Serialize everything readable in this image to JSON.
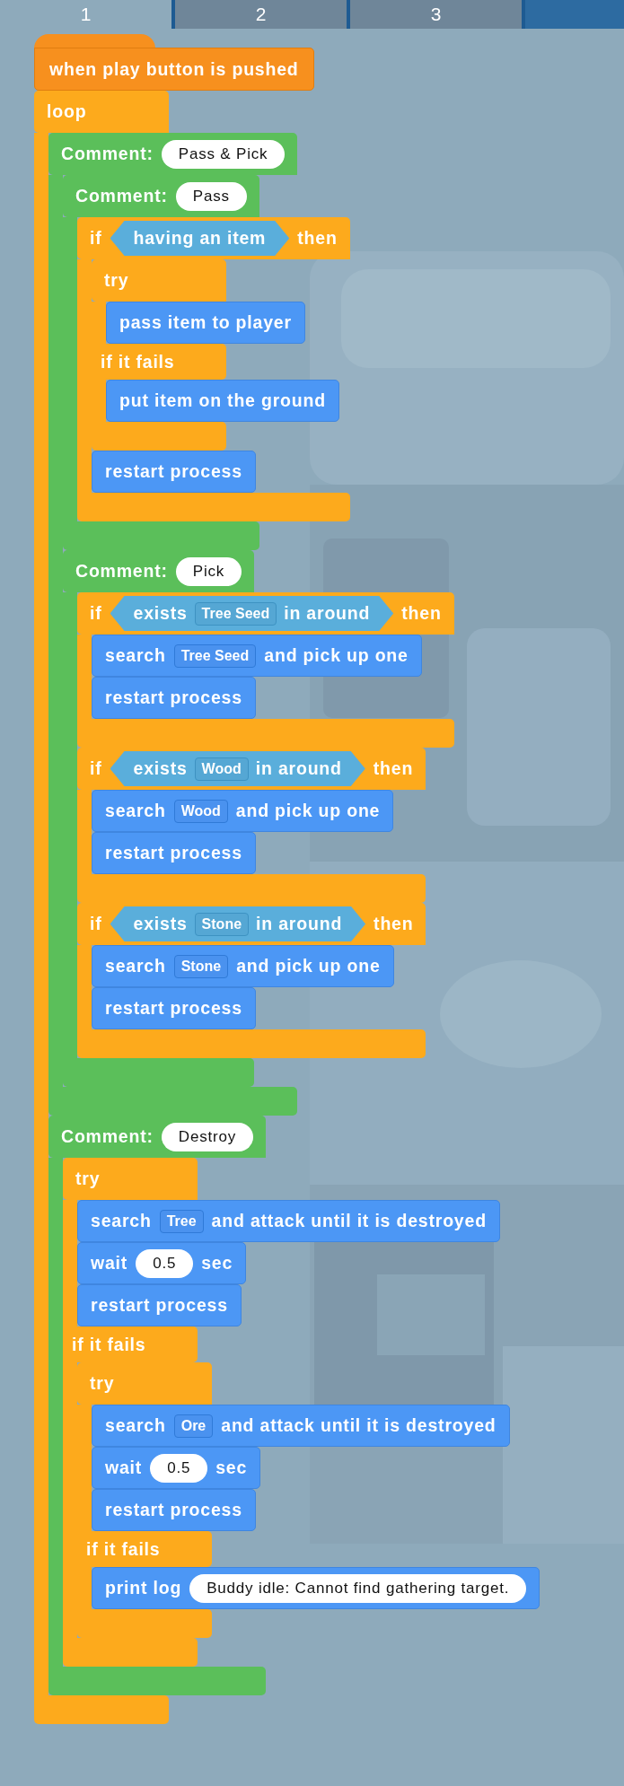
{
  "tabs": [
    {
      "label": "1",
      "selected": true
    },
    {
      "label": "2",
      "selected": false
    },
    {
      "label": "3",
      "selected": false
    }
  ],
  "script": [
    {
      "kind": "hat",
      "text": "when play button is pushed"
    },
    {
      "kind": "loop",
      "label": "loop",
      "body": [
        {
          "kind": "comment",
          "label": "Comment:",
          "value": "Pass & Pick",
          "body": [
            {
              "kind": "comment",
              "label": "Comment:",
              "value": "Pass",
              "body": [
                {
                  "kind": "if",
                  "header": [
                    {
                      "kind": "text",
                      "text": "if"
                    },
                    {
                      "kind": "condition",
                      "segments": [
                        {
                          "kind": "text",
                          "text": "having an item"
                        }
                      ]
                    },
                    {
                      "kind": "text",
                      "text": "then"
                    }
                  ],
                  "body": [
                    {
                      "kind": "try",
                      "label": "try",
                      "body": [
                        {
                          "kind": "command",
                          "segments": [
                            {
                              "kind": "text",
                              "text": "pass item to player"
                            }
                          ]
                        }
                      ],
                      "fail_label": "if it fails",
                      "fail_body": [
                        {
                          "kind": "command",
                          "segments": [
                            {
                              "kind": "text",
                              "text": "put item on the ground"
                            }
                          ]
                        }
                      ]
                    },
                    {
                      "kind": "command",
                      "segments": [
                        {
                          "kind": "text",
                          "text": "restart process"
                        }
                      ]
                    }
                  ]
                }
              ]
            },
            {
              "kind": "comment",
              "label": "Comment:",
              "value": "Pick",
              "body": [
                {
                  "kind": "if",
                  "header": [
                    {
                      "kind": "text",
                      "text": "if"
                    },
                    {
                      "kind": "condition",
                      "segments": [
                        {
                          "kind": "text",
                          "text": "exists"
                        },
                        {
                          "kind": "slot",
                          "text": "Tree Seed"
                        },
                        {
                          "kind": "text",
                          "text": "in around"
                        }
                      ]
                    },
                    {
                      "kind": "text",
                      "text": "then"
                    }
                  ],
                  "body": [
                    {
                      "kind": "command",
                      "segments": [
                        {
                          "kind": "text",
                          "text": "search"
                        },
                        {
                          "kind": "slot",
                          "text": "Tree Seed"
                        },
                        {
                          "kind": "text",
                          "text": "and pick up one"
                        }
                      ]
                    },
                    {
                      "kind": "command",
                      "segments": [
                        {
                          "kind": "text",
                          "text": "restart process"
                        }
                      ]
                    }
                  ]
                },
                {
                  "kind": "if",
                  "header": [
                    {
                      "kind": "text",
                      "text": "if"
                    },
                    {
                      "kind": "condition",
                      "segments": [
                        {
                          "kind": "text",
                          "text": "exists"
                        },
                        {
                          "kind": "slot",
                          "text": "Wood"
                        },
                        {
                          "kind": "text",
                          "text": "in around"
                        }
                      ]
                    },
                    {
                      "kind": "text",
                      "text": "then"
                    }
                  ],
                  "body": [
                    {
                      "kind": "command",
                      "segments": [
                        {
                          "kind": "text",
                          "text": "search"
                        },
                        {
                          "kind": "slot",
                          "text": "Wood"
                        },
                        {
                          "kind": "text",
                          "text": "and pick up one"
                        }
                      ]
                    },
                    {
                      "kind": "command",
                      "segments": [
                        {
                          "kind": "text",
                          "text": "restart process"
                        }
                      ]
                    }
                  ]
                },
                {
                  "kind": "if",
                  "header": [
                    {
                      "kind": "text",
                      "text": "if"
                    },
                    {
                      "kind": "condition",
                      "segments": [
                        {
                          "kind": "text",
                          "text": "exists"
                        },
                        {
                          "kind": "slot",
                          "text": "Stone"
                        },
                        {
                          "kind": "text",
                          "text": "in around"
                        }
                      ]
                    },
                    {
                      "kind": "text",
                      "text": "then"
                    }
                  ],
                  "body": [
                    {
                      "kind": "command",
                      "segments": [
                        {
                          "kind": "text",
                          "text": "search"
                        },
                        {
                          "kind": "slot",
                          "text": "Stone"
                        },
                        {
                          "kind": "text",
                          "text": "and pick up one"
                        }
                      ]
                    },
                    {
                      "kind": "command",
                      "segments": [
                        {
                          "kind": "text",
                          "text": "restart process"
                        }
                      ]
                    }
                  ]
                }
              ]
            }
          ]
        },
        {
          "kind": "comment",
          "label": "Comment:",
          "value": "Destroy",
          "body": [
            {
              "kind": "try",
              "label": "try",
              "body": [
                {
                  "kind": "command",
                  "segments": [
                    {
                      "kind": "text",
                      "text": "search"
                    },
                    {
                      "kind": "slot",
                      "text": "Tree"
                    },
                    {
                      "kind": "text",
                      "text": "and attack until it is destroyed"
                    }
                  ]
                },
                {
                  "kind": "command",
                  "segments": [
                    {
                      "kind": "text",
                      "text": "wait"
                    },
                    {
                      "kind": "pill",
                      "text": "0.5"
                    },
                    {
                      "kind": "text",
                      "text": "sec"
                    }
                  ]
                },
                {
                  "kind": "command",
                  "segments": [
                    {
                      "kind": "text",
                      "text": "restart process"
                    }
                  ]
                }
              ],
              "fail_label": "if it fails",
              "fail_body": [
                {
                  "kind": "try",
                  "label": "try",
                  "body": [
                    {
                      "kind": "command",
                      "segments": [
                        {
                          "kind": "text",
                          "text": "search"
                        },
                        {
                          "kind": "slot",
                          "text": "Ore"
                        },
                        {
                          "kind": "text",
                          "text": "and attack until it is destroyed"
                        }
                      ]
                    },
                    {
                      "kind": "command",
                      "segments": [
                        {
                          "kind": "text",
                          "text": "wait"
                        },
                        {
                          "kind": "pill",
                          "text": "0.5"
                        },
                        {
                          "kind": "text",
                          "text": "sec"
                        }
                      ]
                    },
                    {
                      "kind": "command",
                      "segments": [
                        {
                          "kind": "text",
                          "text": "restart process"
                        }
                      ]
                    }
                  ],
                  "fail_label": "if it fails",
                  "fail_body": [
                    {
                      "kind": "command",
                      "segments": [
                        {
                          "kind": "text",
                          "text": "print log"
                        },
                        {
                          "kind": "pill",
                          "text": "Buddy idle: Cannot find gathering target."
                        }
                      ]
                    }
                  ]
                }
              ]
            }
          ]
        }
      ]
    }
  ]
}
